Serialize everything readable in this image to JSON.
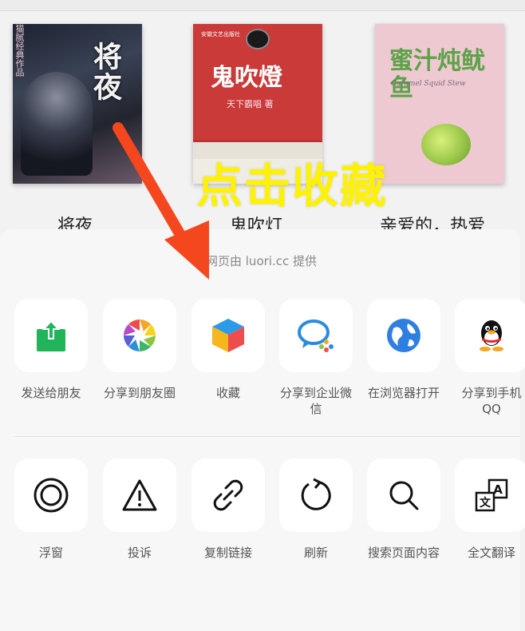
{
  "books": [
    {
      "cover_title": "将夜",
      "cover_subtitle": "猫腻经典作品",
      "title": "将夜"
    },
    {
      "cover_title": "鬼吹燈",
      "cover_subtitle": "天下霸唱 著",
      "cover_publisher": "安徽文艺出版社",
      "title": "鬼吹灯"
    },
    {
      "cover_title": "蜜汁炖鱿鱼",
      "cover_subtitle": "Caramel Squid Stew",
      "title": "亲爱的，热爱"
    }
  ],
  "annotation": "点击收藏",
  "share_sheet": {
    "provided_by": "网页由 luori.cc 提供",
    "row1": [
      {
        "label": "发送给朋友",
        "icon": "send-to-friend-icon"
      },
      {
        "label": "分享到朋友圈",
        "icon": "moments-icon"
      },
      {
        "label": "收藏",
        "icon": "favorite-cube-icon"
      },
      {
        "label": "分享到企业微信",
        "icon": "wecom-icon"
      },
      {
        "label": "在浏览器打开",
        "icon": "browser-globe-icon"
      },
      {
        "label": "分享到手机QQ",
        "icon": "qq-penguin-icon"
      }
    ],
    "row2": [
      {
        "label": "浮窗",
        "icon": "float-window-icon"
      },
      {
        "label": "投诉",
        "icon": "warning-icon"
      },
      {
        "label": "复制链接",
        "icon": "link-icon"
      },
      {
        "label": "刷新",
        "icon": "refresh-icon"
      },
      {
        "label": "搜索页面内容",
        "icon": "search-icon"
      },
      {
        "label": "全文翻译",
        "icon": "translate-icon"
      }
    ]
  },
  "colors": {
    "annotation": "#fff200",
    "arrow": "#f4471e",
    "send_green": "#22b45a",
    "globe_blue": "#2f7fe0"
  }
}
